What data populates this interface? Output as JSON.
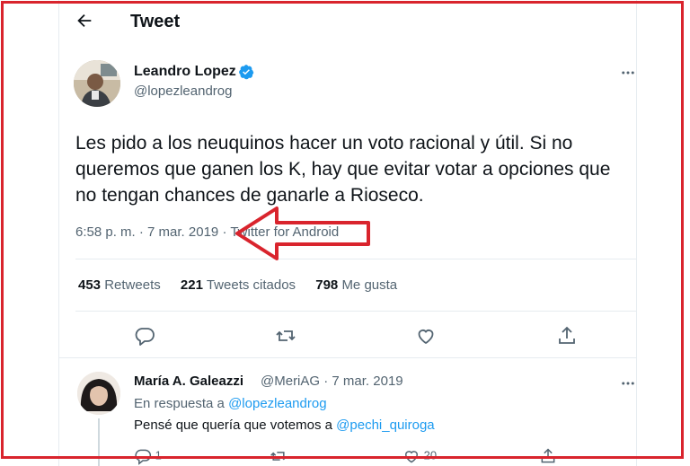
{
  "header": {
    "title": "Tweet"
  },
  "tweet": {
    "author_name": "Leandro Lopez",
    "author_handle": "@lopezleandrog",
    "text": "Les pido a los neuquinos hacer un voto racional y útil. Si no queremos que ganen los K, hay que evitar votar a opciones que no tengan chances de ganarle a Rioseco.",
    "time": "6:58 p. m.",
    "date": "7 mar. 2019",
    "source": "Twitter for Android",
    "retweets_count": "453",
    "retweets_label": "Retweets",
    "quotes_count": "221",
    "quotes_label": "Tweets citados",
    "likes_count": "798",
    "likes_label": "Me gusta"
  },
  "reply": {
    "author_name": "María A. Galeazzi",
    "author_handle": "@MeriAG",
    "date": "7 mar. 2019",
    "in_reply_prefix": "En respuesta a",
    "in_reply_handle": "@lopezleandrog",
    "text_prefix": "Pensé que quería que votemos a",
    "mention": "@pechi_quiroga",
    "reply_count": "1",
    "like_count": "20"
  },
  "colors": {
    "accent": "#1d9bf0",
    "annotation": "#d9242d",
    "text": "#0f1419",
    "muted": "#536471"
  }
}
